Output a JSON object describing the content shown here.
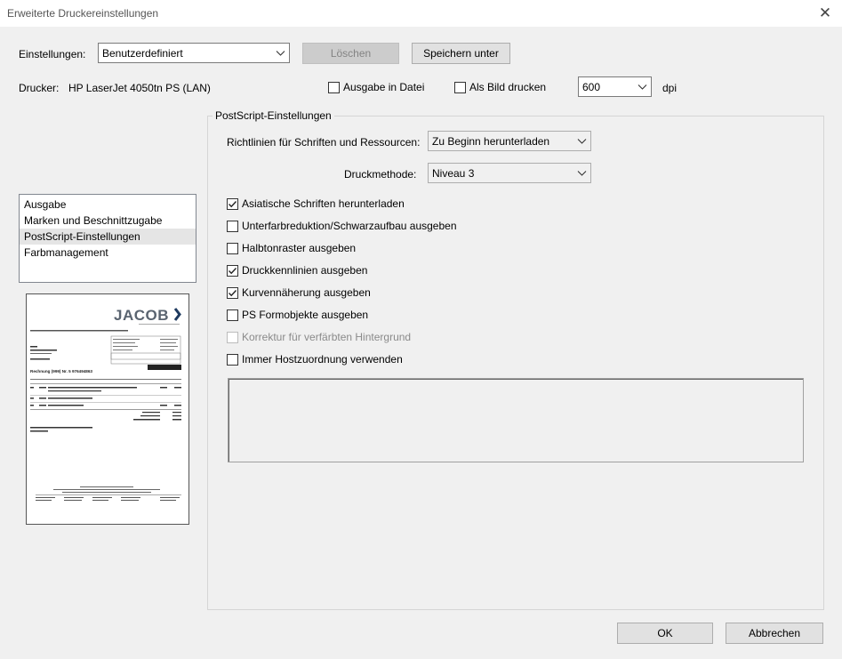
{
  "window": {
    "title": "Erweiterte Druckereinstellungen",
    "close_glyph": "✕"
  },
  "settings": {
    "label": "Einstellungen:",
    "value": "Benutzerdefiniert",
    "delete_label": "Löschen",
    "save_as_label": "Speichern unter"
  },
  "printer": {
    "label": "Drucker:",
    "name": "HP LaserJet 4050tn PS (LAN)",
    "output_to_file": {
      "label": "Ausgabe in Datei",
      "checked": false
    },
    "print_as_image": {
      "label": "Als Bild drucken",
      "checked": false
    },
    "dpi_value": "600",
    "dpi_label": "dpi"
  },
  "sidebar": {
    "items": [
      {
        "label": "Ausgabe",
        "selected": false
      },
      {
        "label": "Marken und Beschnittzugabe",
        "selected": false
      },
      {
        "label": "PostScript-Einstellungen",
        "selected": true
      },
      {
        "label": "Farbmanagement",
        "selected": false
      }
    ]
  },
  "postscript": {
    "group_label": "PostScript-Einstellungen",
    "font_policy_label": "Richtlinien für Schriften und Ressourcen:",
    "font_policy_value": "Zu Beginn herunterladen",
    "print_method_label": "Druckmethode:",
    "print_method_value": "Niveau 3",
    "options": [
      {
        "label": "Asiatische Schriften herunterladen",
        "checked": true,
        "enabled": true
      },
      {
        "label": "Unterfarbreduktion/Schwarzaufbau ausgeben",
        "checked": false,
        "enabled": true
      },
      {
        "label": "Halbtonraster ausgeben",
        "checked": false,
        "enabled": true
      },
      {
        "label": "Druckkennlinien ausgeben",
        "checked": true,
        "enabled": true
      },
      {
        "label": "Kurvennäherung ausgeben",
        "checked": true,
        "enabled": true
      },
      {
        "label": "PS Formobjekte ausgeben",
        "checked": false,
        "enabled": true
      },
      {
        "label": "Korrektur für verfärbten Hintergrund",
        "checked": false,
        "enabled": false
      },
      {
        "label": "Immer Hostzuordnung verwenden",
        "checked": false,
        "enabled": true
      }
    ]
  },
  "preview": {
    "logo_text": "JACOB",
    "invoice_title": "Rechnung (999) Nr. 5 976494863"
  },
  "footer": {
    "ok_label": "OK",
    "cancel_label": "Abbrechen"
  },
  "colors": {
    "dialog_bg": "#f0f0f0",
    "button_bg": "#e1e1e1",
    "disabled_button_bg": "#cccccc",
    "selection_bg": "#e5e5e5",
    "logo_accent": "#1e3a5f"
  }
}
